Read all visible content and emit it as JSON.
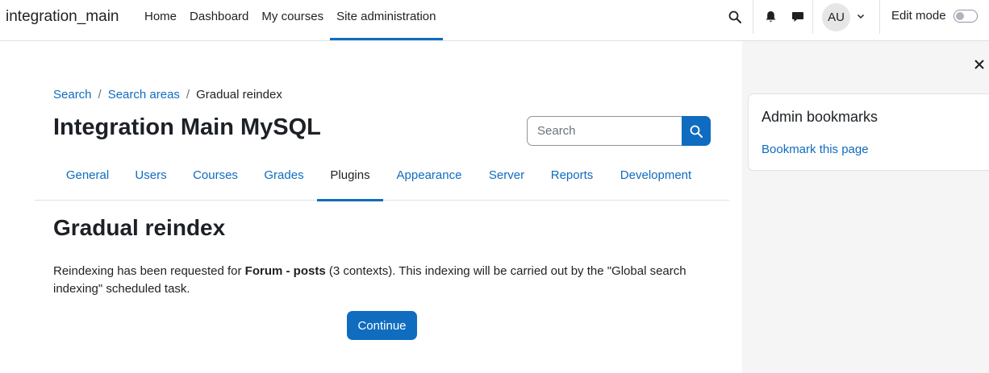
{
  "navbar": {
    "brand": "integration_main",
    "items": [
      {
        "label": "Home",
        "active": false
      },
      {
        "label": "Dashboard",
        "active": false
      },
      {
        "label": "My courses",
        "active": false
      },
      {
        "label": "Site administration",
        "active": true
      }
    ],
    "avatar_initials": "AU",
    "edit_mode_label": "Edit mode",
    "edit_mode_on": false
  },
  "icons": {
    "search": "search-icon",
    "notifications": "bell-icon",
    "messages": "chat-bubble-icon",
    "user_menu_caret": "chevron-down-icon",
    "drawer_close": "close-icon"
  },
  "breadcrumb": {
    "items": [
      {
        "label": "Search",
        "link": true
      },
      {
        "label": "Search areas",
        "link": true
      },
      {
        "label": "Gradual reindex",
        "link": false
      }
    ],
    "separator": "/"
  },
  "page": {
    "title": "Integration Main MySQL"
  },
  "search": {
    "placeholder": "Search"
  },
  "tabs": [
    {
      "label": "General",
      "active": false
    },
    {
      "label": "Users",
      "active": false
    },
    {
      "label": "Courses",
      "active": false
    },
    {
      "label": "Grades",
      "active": false
    },
    {
      "label": "Plugins",
      "active": true
    },
    {
      "label": "Appearance",
      "active": false
    },
    {
      "label": "Server",
      "active": false
    },
    {
      "label": "Reports",
      "active": false
    },
    {
      "label": "Development",
      "active": false
    }
  ],
  "content": {
    "heading": "Gradual reindex",
    "message_prefix": "Reindexing has been requested for ",
    "message_bold": "Forum - posts",
    "message_suffix": " (3 contexts). This indexing will be carried out by the \"Global search indexing\" scheduled task.",
    "continue_label": "Continue"
  },
  "drawer": {
    "block_title": "Admin bookmarks",
    "bookmark_link": "Bookmark this page"
  },
  "colors": {
    "primary": "#0f6cbf",
    "text": "#1d2125",
    "drawer_bg": "#f5f5f5",
    "border": "#dee2e6"
  }
}
